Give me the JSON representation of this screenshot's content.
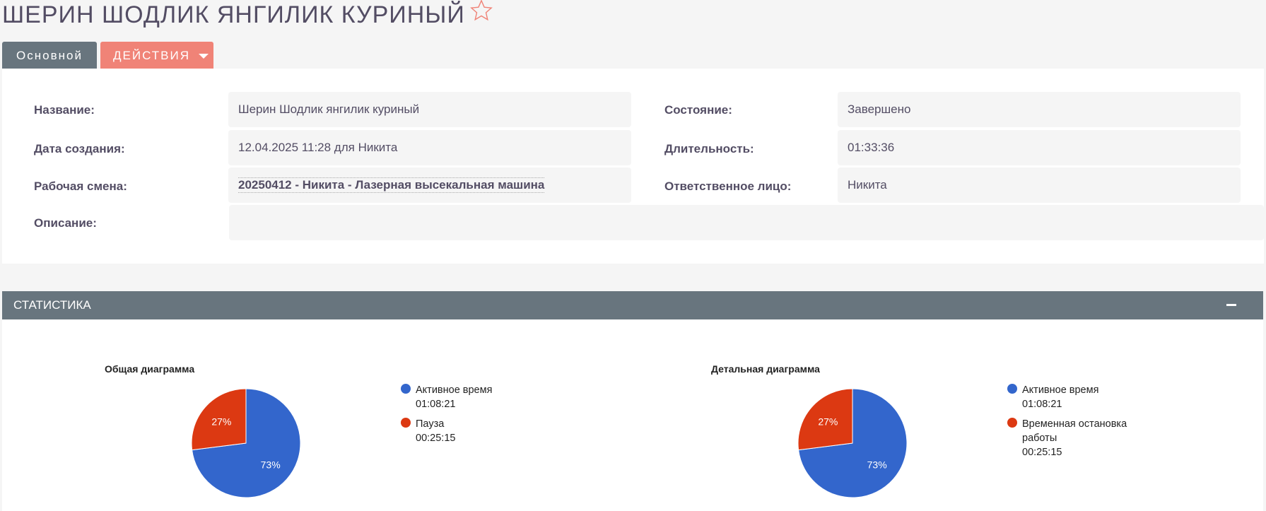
{
  "page": {
    "title": "ШЕРИН ШОДЛИК ЯНГИЛИК КУРИНЫЙ"
  },
  "tabs": {
    "main_label": "Основной",
    "actions_label": "ДЕЙСТВИЯ"
  },
  "details": {
    "name_label": "Название:",
    "name_value": "Шерин Шодлик янгилик куриный",
    "created_label": "Дата создания:",
    "created_value": "12.04.2025 11:28 для Никита",
    "shift_label": "Рабочая смена:",
    "shift_value": "20250412 - Никита - Лазерная высекальная машина",
    "description_label": "Описание:",
    "description_value": "",
    "state_label": "Состояние:",
    "state_value": "Завершено",
    "duration_label": "Длительность:",
    "duration_value": "01:33:36",
    "responsible_label": "Ответственное лицо:",
    "responsible_value": "Никита"
  },
  "stats": {
    "header": "СТАТИСТИКА"
  },
  "colors": {
    "accent_gray": "#68757e",
    "accent_salmon": "#f08377",
    "active_blue": "#3366cc",
    "pause_red": "#dc3912"
  },
  "chart_data": [
    {
      "type": "pie",
      "title": "Общая диаграмма",
      "series": [
        {
          "name": "Активное время",
          "time": "01:08:21",
          "value": 73,
          "label": "73%",
          "color": "#3366cc"
        },
        {
          "name": "Пауза",
          "time": "00:25:15",
          "value": 27,
          "label": "27%",
          "color": "#dc3912"
        }
      ],
      "legend": "right"
    },
    {
      "type": "pie",
      "title": "Детальная диаграмма",
      "series": [
        {
          "name": "Активное время",
          "time": "01:08:21",
          "value": 73,
          "label": "73%",
          "color": "#3366cc"
        },
        {
          "name": "Временная остановка работы",
          "time": "00:25:15",
          "value": 27,
          "label": "27%",
          "color": "#dc3912"
        }
      ],
      "legend": "right"
    }
  ]
}
